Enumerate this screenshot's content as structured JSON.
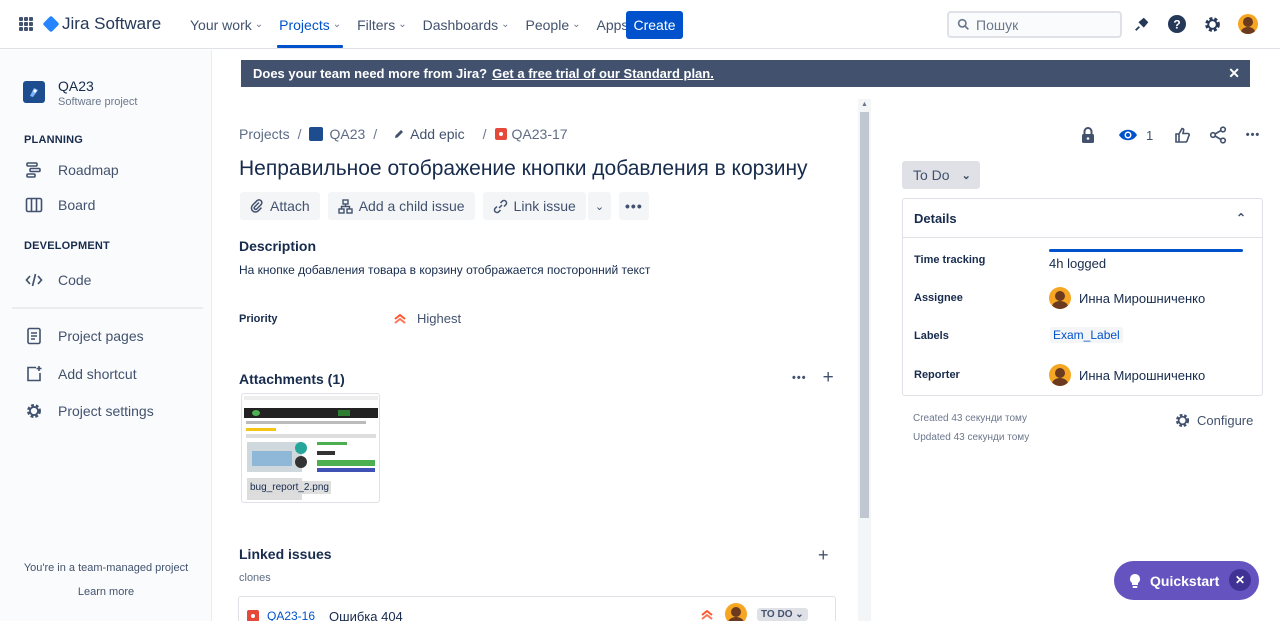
{
  "topnav": {
    "product": "Jira Software",
    "items": [
      {
        "label": "Your work"
      },
      {
        "label": "Projects"
      },
      {
        "label": "Filters"
      },
      {
        "label": "Dashboards"
      },
      {
        "label": "People"
      },
      {
        "label": "Apps"
      }
    ],
    "active_item": "Projects",
    "create_label": "Create",
    "search_placeholder": "Пошук",
    "icons": [
      "notifications-icon",
      "help-icon",
      "settings-icon",
      "avatar"
    ]
  },
  "sidebar": {
    "project_name": "QA23",
    "project_type": "Software project",
    "planning_label": "PLANNING",
    "planning_items": [
      {
        "label": "Roadmap"
      },
      {
        "label": "Board"
      }
    ],
    "development_label": "DEVELOPMENT",
    "development_items": [
      {
        "label": "Code"
      }
    ],
    "other_items": [
      {
        "label": "Project pages"
      },
      {
        "label": "Add shortcut"
      },
      {
        "label": "Project settings"
      }
    ],
    "footer_text": "You're in a team-managed project",
    "footer_link": "Learn more"
  },
  "banner": {
    "text": "Does your team need more from Jira?",
    "link": "Get a free trial of our Standard plan."
  },
  "issue": {
    "breadcrumb": [
      "Projects",
      "QA23",
      "Add epic",
      "QA23-17"
    ],
    "title": "Неправильное отображение кнопки добавления в корзину",
    "toolbar": {
      "attach": "Attach",
      "add_child": "Add a child issue",
      "link_issue": "Link issue"
    },
    "description_label": "Description",
    "description": "На кнопке добавления товара в корзину отображается посторонний текст",
    "priority_label": "Priority",
    "priority_value": "Highest",
    "attachments_label": "Attachments (1)",
    "attachment_name": "bug_report_2.png",
    "linked_label": "Linked issues",
    "link_type": "clones",
    "linked": {
      "key": "QA23-16",
      "summary": "Ошибка 404",
      "status": "TO DO"
    }
  },
  "right_panel": {
    "watchers": "1",
    "status": "To Do",
    "details_label": "Details",
    "time_tracking_label": "Time tracking",
    "time_logged": "4h logged",
    "assignee_label": "Assignee",
    "assignee": "Инна Мирошниченко",
    "labels_label": "Labels",
    "label_value": "Exam_Label",
    "reporter_label": "Reporter",
    "reporter": "Инна Мирошниченко",
    "created": "Created 43 секунди тому",
    "updated": "Updated 43 секунди тому",
    "configure": "Configure"
  },
  "quickstart": {
    "label": "Quickstart"
  },
  "colors": {
    "brand": "#0052cc",
    "banner": "#42526e",
    "quickstart": "#6554c0",
    "bug": "#e5493a",
    "priority": "#ff5630"
  }
}
